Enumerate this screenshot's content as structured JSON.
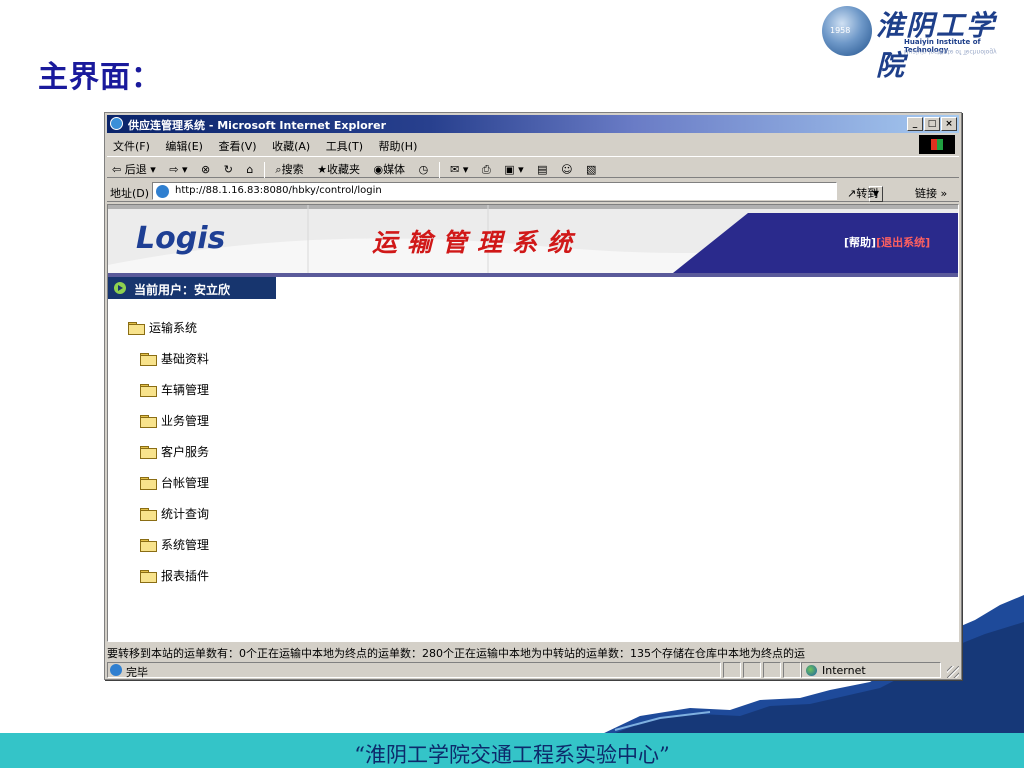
{
  "slide": {
    "title": "主界面：",
    "footer": "“淮阴工学院交通工程系实验中心”",
    "logo": {
      "cn": "淮阴工学院",
      "en": "Huaiyin Institute of Technology",
      "year": "1958"
    }
  },
  "window": {
    "title": "供应连管理系统 - Microsoft Internet Explorer",
    "buttons": {
      "minimize": "_",
      "maximize": "□",
      "close": "×"
    }
  },
  "menu": [
    "文件(F)",
    "编辑(E)",
    "查看(V)",
    "收藏(A)",
    "工具(T)",
    "帮助(H)"
  ],
  "toolbar": {
    "back": "⇦ 后退 ▾",
    "forward": "⇨ ▾",
    "stop": "⊗",
    "refresh": "↻",
    "home": "⌂",
    "search": "搜索",
    "favorites": "收藏夹",
    "media": "媒体",
    "history": "◷",
    "mail": "✉ ▾",
    "print": "⎙",
    "edit": "▣ ▾",
    "discuss": "▤",
    "messenger": "☺",
    "extra": "▧"
  },
  "address": {
    "label": "地址(D)",
    "url": "http://88.1.16.83:8080/hbky/control/login",
    "go": "转到",
    "links": "链接 »"
  },
  "app": {
    "logo": "Logis",
    "title": "运输管理系统",
    "help": "[帮助]",
    "logout": "[退出系统]",
    "user_label": "当前用户：安立欣",
    "tree": {
      "root": "运输系统",
      "items": [
        "基础资料",
        "车辆管理",
        "业务管理",
        "客户服务",
        "台帐管理",
        "统计查询",
        "系统管理",
        "报表插件"
      ]
    },
    "marquee": "要转移到本站的运单数有：0个正在运输中本地为终点的运单数：280个正在运输中本地为中转站的运单数：135个存储在仓库中本地为终点的运"
  },
  "status": {
    "done": "完毕",
    "zone": "Internet"
  },
  "colors": {
    "slide_title": "#1a1a9c",
    "footer_bar": "#34c4c8",
    "header_band": "#2a2a8c",
    "system_title": "#d01818",
    "user_bar": "#17356e"
  }
}
